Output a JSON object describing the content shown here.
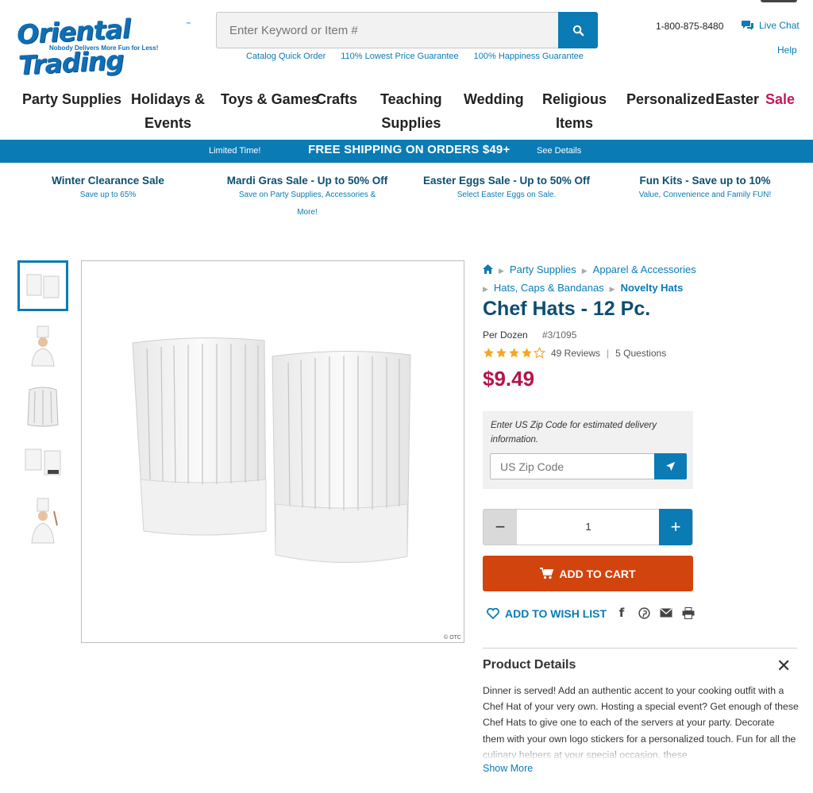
{
  "header": {
    "logo_text": "Oriental Trading",
    "logo_tagline": "Nobody Delivers More Fun for Less!",
    "logo_tm": "™",
    "search_placeholder": "Enter Keyword or Item #",
    "sub_links": [
      "Catalog Quick Order",
      "110% Lowest Price Guarantee",
      "100% Happiness Guarantee"
    ],
    "phone": "1-800-875-8480",
    "live_chat": "Live Chat",
    "help": "Help"
  },
  "nav": {
    "items": [
      {
        "line1": "Party Supplies",
        "line2": ""
      },
      {
        "line1": "Holidays &",
        "line2": "Events"
      },
      {
        "line1": "Toys & Games",
        "line2": ""
      },
      {
        "line1": "Crafts",
        "line2": ""
      },
      {
        "line1": "Teaching",
        "line2": "Supplies"
      },
      {
        "line1": "Wedding",
        "line2": ""
      },
      {
        "line1": "Religious",
        "line2": "Items"
      },
      {
        "line1": "Personalized",
        "line2": ""
      },
      {
        "line1": "Easter",
        "line2": ""
      },
      {
        "line1": "Sale",
        "line2": ""
      }
    ]
  },
  "shipping_banner": {
    "left": "Limited Time!",
    "main": "FREE SHIPPING ON ORDERS $49+",
    "right": "See Details"
  },
  "promos": [
    {
      "title": "Winter Clearance Sale",
      "sub1": "Save up to 65%",
      "sub2": ""
    },
    {
      "title": "Mardi Gras Sale - Up to 50% Off",
      "sub1": "Save on Party Supplies, Accessories &",
      "sub2": "More!"
    },
    {
      "title": "Easter Eggs Sale - Up to 50% Off",
      "sub1": "Select Easter Eggs on Sale.",
      "sub2": ""
    },
    {
      "title": "Fun Kits - Save up to 10%",
      "sub1": "Value, Convenience and Family FUN!",
      "sub2": ""
    }
  ],
  "image_mark": "© OTC",
  "breadcrumb": {
    "items": [
      "Party Supplies",
      "Apparel & Accessories",
      "Hats, Caps & Bandanas",
      "Novelty Hats"
    ]
  },
  "product": {
    "title": "Chef Hats - 12 Pc.",
    "unit": "Per Dozen",
    "item_number": "#3/1095",
    "rating": 4,
    "reviews": "49 Reviews",
    "questions": "5 Questions",
    "price": "$9.49"
  },
  "zip": {
    "note": "Enter US Zip Code for estimated delivery information.",
    "placeholder": "US Zip Code"
  },
  "quantity": {
    "minus": "−",
    "value": "1",
    "plus": "+"
  },
  "add_to_cart": "ADD TO CART",
  "wish_list": "ADD TO WISH LIST",
  "details": {
    "title": "Product Details",
    "close": "✕",
    "text": "Dinner is served! Add an authentic accent to your cooking outfit with a Chef Hat of your very own. Hosting a special event? Get enough of these Chef Hats to give one to each of the servers at your party. Decorate them with your own logo stickers for a personalized touch. Fun for all the culinary helpers at your special occasion, these",
    "show_more": "Show More"
  },
  "colors": {
    "brand_blue": "#0a7bb5",
    "title_navy": "#0d4e70",
    "price_red": "#b4154a",
    "cart_orange": "#d2440d",
    "sale_pink": "#c2185b"
  }
}
